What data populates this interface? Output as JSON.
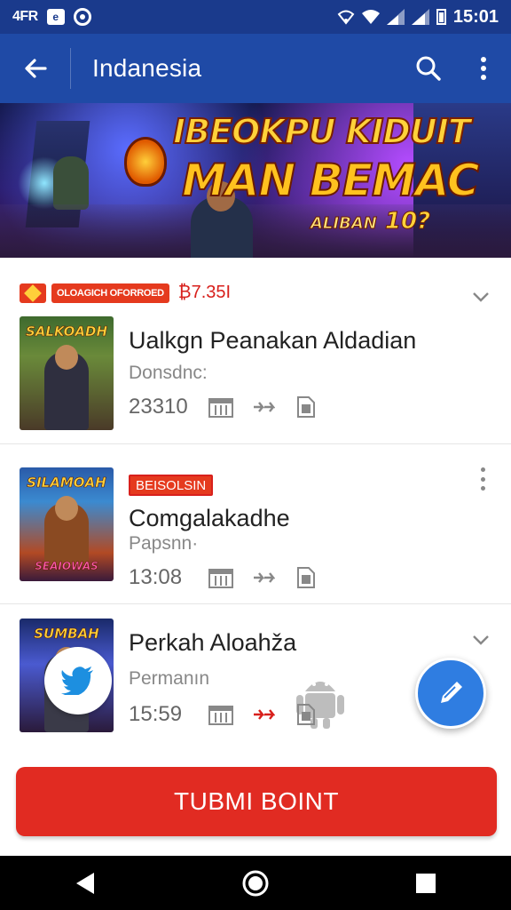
{
  "status_bar": {
    "left_text": "4FR",
    "box_icon_letter": "e",
    "time": "15:01"
  },
  "app_bar": {
    "title": "Indanesia"
  },
  "banner": {
    "line1": "IBEOKPU",
    "line1_b": "KIDUIT",
    "line2": "MAN BEMAC",
    "line3_small": "ALIBAN",
    "line3_num": "10?"
  },
  "items": [
    {
      "tag_text": "OLOAGICH OFORROED",
      "price": "₿7.35I",
      "thumb_title": "SALKOADH",
      "title": "Ualkgn Peanakan Aldadian",
      "subtitle": "Donsdnc:",
      "stat": "23310"
    },
    {
      "badge": "BEISOLSIN",
      "thumb_title": "SILAMOAH",
      "thumb_sub": "SEAIOWAS",
      "title": "Comgalakadhe",
      "subtitle": "Papsnn·",
      "stat": "13:08"
    },
    {
      "thumb_title": "SUMBAH",
      "title": "Perkah Aloahža",
      "subtitle": "Permanın",
      "stat": "15:59"
    }
  ],
  "bottom_button": {
    "label": "TUBMI BOINT"
  },
  "colors": {
    "status_bar": "#1a3a8c",
    "app_bar": "#1f4aa6",
    "primary": "#e12b22",
    "fab": "#2f7de1"
  }
}
